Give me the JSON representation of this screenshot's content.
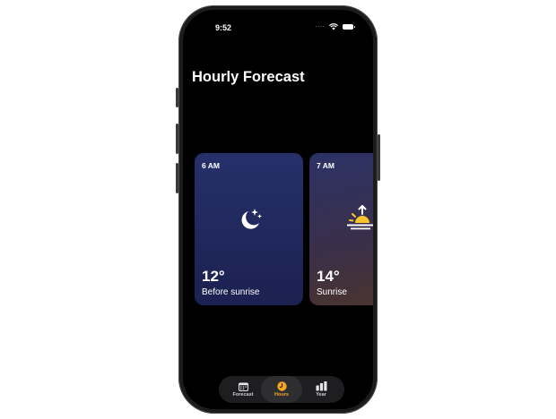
{
  "status_bar": {
    "time": "9:52",
    "signal_icon": "signal-dots-icon",
    "wifi_icon": "wifi-icon",
    "battery_icon": "battery-icon"
  },
  "page": {
    "title": "Hourly Forecast"
  },
  "cards": [
    {
      "time": "6 AM",
      "temperature": "12°",
      "description": "Before sunrise",
      "icon": "moon-stars-icon"
    },
    {
      "time": "7 AM",
      "temperature": "14°",
      "description": "Sunrise",
      "icon": "sunrise-icon"
    }
  ],
  "tabbar": {
    "tabs": [
      {
        "label": "Forecast",
        "icon": "calendar-icon",
        "active": false
      },
      {
        "label": "Hours",
        "icon": "clock-icon",
        "active": true
      },
      {
        "label": "Year",
        "icon": "bar-chart-icon",
        "active": false
      }
    ]
  },
  "colors": {
    "accent": "#f5a623",
    "background": "#000000",
    "card_night": "#222a5e"
  }
}
